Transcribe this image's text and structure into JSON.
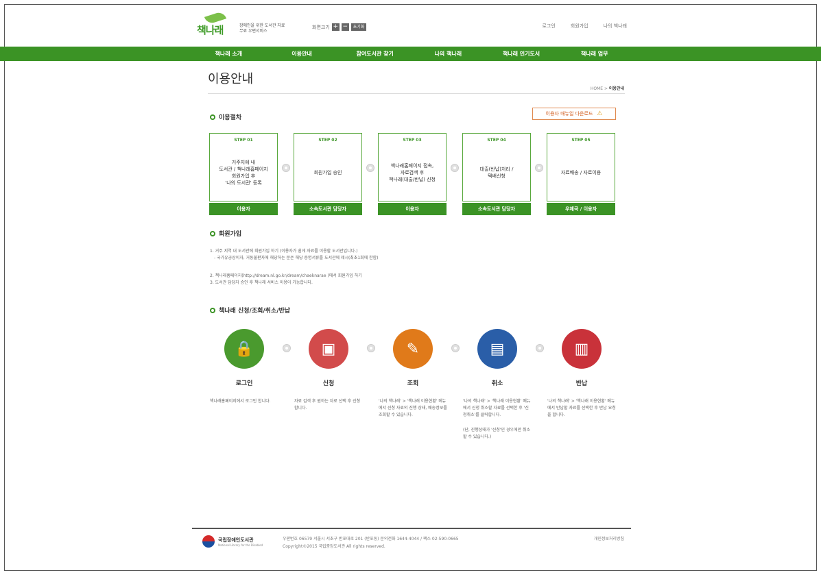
{
  "header": {
    "logo_text": "책나래",
    "tagline": "장애인을 위한 도서관 자료 무료 우편서비스",
    "font_size_label": "화면크기",
    "font_plus": "+",
    "font_minus": "−",
    "font_reset": "초기화",
    "util_links": [
      "로그인",
      "회원가입",
      "나의 책나래"
    ]
  },
  "gnb": [
    "책나래 소개",
    "이용안내",
    "참여도서관 찾기",
    "나의 책나래",
    "책나래 인기도서",
    "책나래 업무"
  ],
  "page": {
    "title": "이용안내",
    "breadcrumb_home": "HOME",
    "breadcrumb_sep": ">",
    "breadcrumb_current": "이용안내"
  },
  "process": {
    "heading": "이용절차",
    "download_label": "이용자 매뉴얼 다운로드",
    "steps": [
      {
        "no": "STEP 01",
        "desc": "거주지에 내\n도서관 / 책나래홈페이지\n회원가입 후\n'나의 도서관' 등록",
        "role": "이용자"
      },
      {
        "no": "STEP 02",
        "desc": "회원가입 승인",
        "role": "소속도서관 담당자"
      },
      {
        "no": "STEP 03",
        "desc": "책나래홈페이지 접속,\n자료검색 후\n책나래(대출/반납) 신청",
        "role": "이용자"
      },
      {
        "no": "STEP 04",
        "desc": "대출(반납)처리 /\n택배신청",
        "role": "소속도서관 담당자"
      },
      {
        "no": "STEP 05",
        "desc": "자료배송 / 자료이용",
        "role": "우체국 / 이용자"
      }
    ]
  },
  "join": {
    "heading": "회원가입",
    "line1": "1. 거주 지역 내 도서관에 회원가입 하기 (이용자가 쉽게 자료를 이용할 도서관입니다.)",
    "line2": "- 국가유공상이자, 거동불편자에 해당하는 분은 해당 증명서류를 도서관에 제시(최초1회에 한함)",
    "line3": "2. 책나래홈페이지(http://dream.nl.go.kr/dream/chaeknarae )에서 회원가입 하기",
    "line4": "3. 도서관 담당자 승인 후 책나래 서비스 이용이 가능합니다."
  },
  "service": {
    "heading": "책나래 신청/조회/취소/반납",
    "items": [
      {
        "icon": "lock-icon",
        "glyph": "🔒",
        "color": "#4a9a2e",
        "title": "로그인",
        "desc": "책나래홈페이지에서 로그인 합니다.",
        "note": ""
      },
      {
        "icon": "monitor-icon",
        "glyph": "▣",
        "color": "#d24b4b",
        "title": "신청",
        "desc": "자료 검색 후 원하는 자료 선택 후 신청합니다.",
        "note": ""
      },
      {
        "icon": "notebook-icon",
        "glyph": "✎",
        "color": "#e07a1a",
        "title": "조회",
        "desc": "'나의 책나래' > '책나래 이용현황' 메뉴에서 신청 자료의 진행 상태, 배송정보를 조회할 수 있습니다.",
        "note": ""
      },
      {
        "icon": "document-cancel-icon",
        "glyph": "▤",
        "color": "#2a5ea8",
        "title": "취소",
        "desc": "'나의 책나래' > '책나래 이용현황' 메뉴에서 신청 취소할 자료를 선택한 후 '신청취소'를 클릭합니다.",
        "note": "(단, 진행상태가 '신청'인 경우에만 취소할 수 있습니다.)"
      },
      {
        "icon": "books-icon",
        "glyph": "▥",
        "color": "#c9323a",
        "title": "반납",
        "desc": "'나의 책나래' > '책나래 이용현황' 메뉴에서 반납할 자료를 선택한 후 반납 요청을 합니다.",
        "note": ""
      }
    ]
  },
  "footer": {
    "org_name": "국립장애인도서관",
    "org_en": "National Library for the Disabled",
    "address": "우편번호 06579 서울시 서초구 반포대로 201 (반포동) 문의전화 1644-4044 / 팩스 02-590-0665",
    "copyright": "Copyright©2015 국립중앙도서관 All rights reserved.",
    "privacy": "개인정보처리방침"
  }
}
